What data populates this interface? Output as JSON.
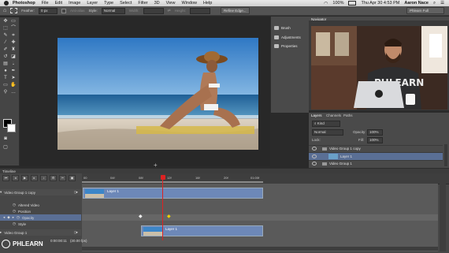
{
  "menubar": {
    "app": "Photoshop",
    "items": [
      "File",
      "Edit",
      "Image",
      "Layer",
      "Type",
      "Select",
      "Filter",
      "3D",
      "View",
      "Window",
      "Help"
    ],
    "battery": "100%",
    "clock": "Thu Apr 30  4:53 PM",
    "user": "Aaron Nace"
  },
  "optbar": {
    "feather_label": "Feather:",
    "feather_value": "0 px",
    "antialias_label": "Anti-alias",
    "style_label": "Style:",
    "style_value": "Normal",
    "width_label": "Width:",
    "height_label": "Height:",
    "refine_button": "Refine Edge...",
    "workspace": "Phlearn Full"
  },
  "midpanel": {
    "items": [
      "Brush",
      "Adjustments",
      "Properties"
    ]
  },
  "navigator": {
    "tab": "Navigator",
    "shirt_text": "PHLEARN"
  },
  "layers": {
    "tabs": [
      "Layers",
      "Channels",
      "Paths"
    ],
    "kind": "Kind",
    "blend": "Normal",
    "opacity_label": "Opacity:",
    "opacity_value": "100%",
    "lock_label": "Lock:",
    "fill_label": "Fill:",
    "fill_value": "100%",
    "rows": [
      "Video Group 1 copy",
      "Layer 1",
      "Video Group 1"
    ]
  },
  "timeline": {
    "title": "Timeline",
    "ruler_ticks": [
      "00",
      "04f",
      "08f",
      "12f",
      "16f",
      "20f",
      "01:00f"
    ],
    "tracks": [
      {
        "label": "Video Group 1 copy",
        "clip": "Layer 1"
      },
      {
        "label": "Altered Video"
      },
      {
        "label": "Position"
      },
      {
        "label": "Opacity"
      },
      {
        "label": "Style"
      },
      {
        "label": "Video Group 1",
        "clip": "Layer 1"
      }
    ],
    "timecode": "0:00:00:11",
    "fps": "(30.00 fps)"
  },
  "watermark": "PHLEARN",
  "colors": {
    "clip": "#6d88b8",
    "playhead": "#dd2222",
    "selected_row": "#5a6f95"
  }
}
